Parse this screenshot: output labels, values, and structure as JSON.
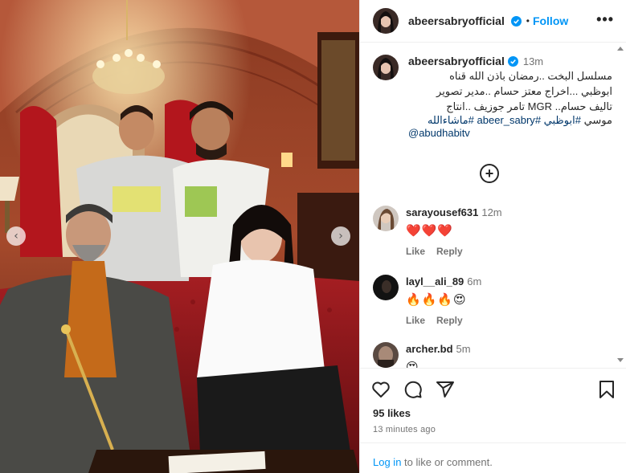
{
  "post": {
    "username": "abeersabryofficial",
    "follow_label": "Follow",
    "separator": "•",
    "more_label": "•••"
  },
  "caption": {
    "username": "abeersabryofficial",
    "time": "13m",
    "line1": "مسلسل البخت ..رمضان باذن الله قناه",
    "line2": "ابوظبي ...اخراج معتز حسام ..مدير تصوير",
    "line3": "تاليف حسام.. MGR تامر جوزيف ..انتاج",
    "tags_prefix": "موسي",
    "tag1": "#ابوظبي",
    "tag2": "#abeer_sabry",
    "tag3": "#ماشاءالله",
    "mention": "@abudhabitv"
  },
  "comments": [
    {
      "username": "sarayousef631",
      "time": "12m",
      "text": "❤️❤️❤️",
      "like_label": "Like",
      "reply_label": "Reply"
    },
    {
      "username": "layl__ali_89",
      "time": "6m",
      "text": "🔥🔥🔥😍",
      "like_label": "Like",
      "reply_label": "Reply"
    },
    {
      "username": "archer.bd",
      "time": "5m",
      "text": "😍"
    }
  ],
  "footer": {
    "likes": "95 likes",
    "posted": "13 minutes ago",
    "login_link": "Log in",
    "login_rest": " to like or comment."
  },
  "media_nav": {
    "prev": "‹",
    "next": "›"
  },
  "colors": {
    "accent": "#0095f6",
    "text": "#262626",
    "muted": "#737373",
    "tag": "#00376b",
    "heart": "#ed4956"
  },
  "icons": [
    "verified-badge-icon",
    "more-options-icon",
    "add-comment-icon",
    "heart-icon",
    "comment-icon",
    "share-icon",
    "bookmark-icon",
    "chevron-left-icon",
    "chevron-right-icon"
  ]
}
